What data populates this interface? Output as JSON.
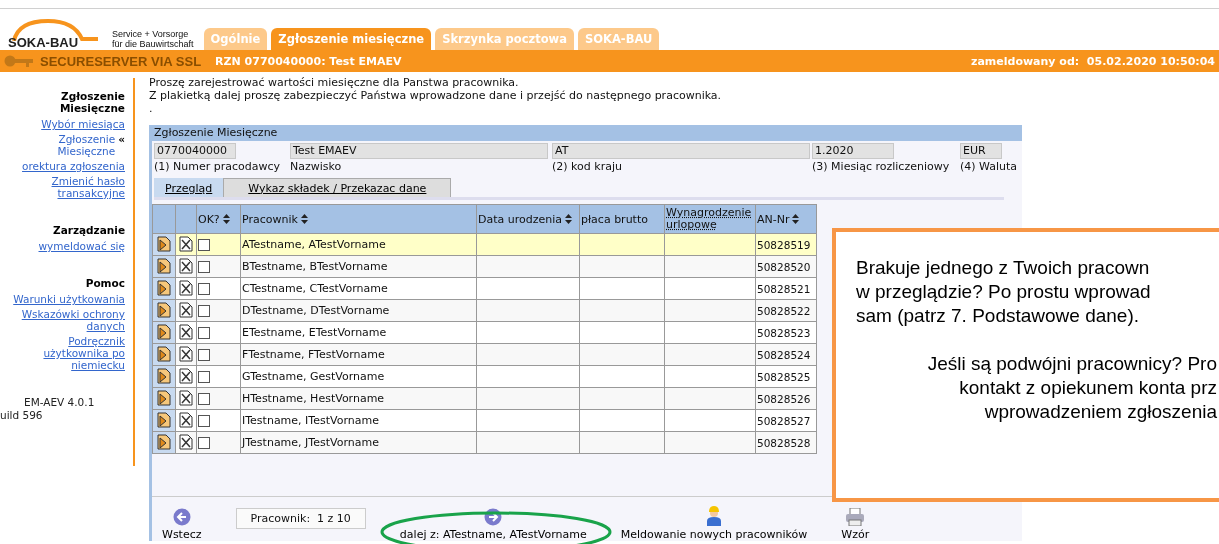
{
  "header": {
    "logo": "SOKA-BAU",
    "tagline": [
      "Service + Vorsorge",
      "für die Bauwirtschaft"
    ],
    "tabs": [
      {
        "label": "Ogólnie",
        "selected": false
      },
      {
        "label": "Zgłoszenie miesięczne",
        "selected": true
      },
      {
        "label": "Skrzynka pocztowa",
        "selected": false
      },
      {
        "label": "SOKA-BAU",
        "selected": false
      }
    ]
  },
  "status_bar": {
    "secure": "SECURESERVER VIA SSL",
    "account": "RZN 0770040000: Test EMAEV",
    "login": "zameldowany od:  05.02.2020 10:50:04"
  },
  "sidebar": {
    "sections": [
      {
        "title": "Zgłoszenie Miesięczne",
        "items": [
          {
            "label": "Wybór miesiąca",
            "current": false
          },
          {
            "label": "Zgłoszenie Miesięczne",
            "current": true,
            "marker": "«"
          },
          {
            "label": "orektura zgłoszenia",
            "current": false
          },
          {
            "label": "Zmienić hasło transakcyjne",
            "current": false
          }
        ]
      },
      {
        "title": "Zarządzanie",
        "items": [
          {
            "label": "wymeldować się",
            "current": false
          }
        ]
      },
      {
        "title": "Pomoc",
        "items": [
          {
            "label": "Warunki użytkowania",
            "current": false
          },
          {
            "label": "Wskazówki ochrony danych",
            "current": false
          },
          {
            "label": "Podręcznik użytkownika po niemiecku",
            "current": false
          }
        ]
      }
    ],
    "version": [
      "EM-AEV 4.0.1",
      "uild 596"
    ]
  },
  "intro": [
    "Proszę zarejestrować wartości miesięczne dla Panstwa pracownika.",
    "Z plakietką dalej proszę zabezpieczyć Państwa wprowadzone dane i przejść do następnego pracownika.",
    "."
  ],
  "panel": {
    "title": "Zgłoszenie Miesięczne",
    "fields": [
      {
        "value": "0770040000",
        "label": "(1) Numer pracodawcy"
      },
      {
        "value": "Test EMAEV",
        "label": "Nazwisko"
      },
      {
        "value": "AT",
        "label": "(2) kod kraju"
      },
      {
        "value": "1.2020",
        "label": "(3) Miesiąc rozliczeniowy"
      },
      {
        "value": "EUR",
        "label": "(4) Waluta"
      }
    ],
    "tabs": [
      {
        "label": "Przegląd",
        "selected": true
      },
      {
        "label": "Wykaz składek / Przekazac dane",
        "selected": false
      }
    ],
    "table": {
      "columns": [
        {
          "label": "OK?",
          "sortable": true,
          "dotted": false
        },
        {
          "label": "Pracownik",
          "sortable": true,
          "dotted": false
        },
        {
          "label": "Data urodzenia",
          "sortable": true,
          "dotted": false
        },
        {
          "label": "płaca brutto",
          "sortable": false,
          "dotted": false
        },
        {
          "label": "Wynagrodzenie urlopowe",
          "sortable": false,
          "dotted": true
        },
        {
          "label": "AN-Nr",
          "sortable": true,
          "dotted": false
        }
      ],
      "rows": [
        {
          "name": "ATestname, ATestVorname",
          "an_nr": "50828519",
          "selected": true,
          "checked": false
        },
        {
          "name": "BTestname, BTestVorname",
          "an_nr": "50828520",
          "selected": false,
          "checked": false
        },
        {
          "name": "CTestname, CTestVorname",
          "an_nr": "50828521",
          "selected": false,
          "checked": false
        },
        {
          "name": "DTestname, DTestVorname",
          "an_nr": "50828522",
          "selected": false,
          "checked": false
        },
        {
          "name": "ETestname, ETestVorname",
          "an_nr": "50828523",
          "selected": false,
          "checked": false
        },
        {
          "name": "FTestname, FTestVorname",
          "an_nr": "50828524",
          "selected": false,
          "checked": false
        },
        {
          "name": "GTestname, GestVorname",
          "an_nr": "50828525",
          "selected": false,
          "checked": false
        },
        {
          "name": "HTestname, HestVorname",
          "an_nr": "50828526",
          "selected": false,
          "checked": false
        },
        {
          "name": "ITestname, ITestVorname",
          "an_nr": "50828527",
          "selected": false,
          "checked": false
        },
        {
          "name": "JTestname, JTestVorname",
          "an_nr": "50828528",
          "selected": false,
          "checked": false
        }
      ]
    },
    "footer": {
      "counter": "Pracownik:  1 z 10",
      "buttons": [
        {
          "kind": "back",
          "label": "Wstecz"
        },
        {
          "kind": "next",
          "label": "dalej z: ATestname, ATestVorname"
        },
        {
          "kind": "person",
          "label": "Meldowanie nowych pracowników"
        },
        {
          "kind": "printer",
          "label": "Wzór"
        }
      ]
    }
  },
  "callout": {
    "paragraphs": [
      {
        "kind": "left",
        "lines": [
          "Brakuje jednego z Twoich pracown",
          "w przeglądzie? Po prostu wprowad",
          "sam (patrz 7. Podstawowe dane)."
        ]
      },
      {
        "kind": "centered",
        "lines": [
          "Jeśli są podwójni pracownicy? Pro",
          "kontakt z opiekunem konta prz",
          "wprowadzeniem zgłoszenia"
        ]
      }
    ]
  }
}
